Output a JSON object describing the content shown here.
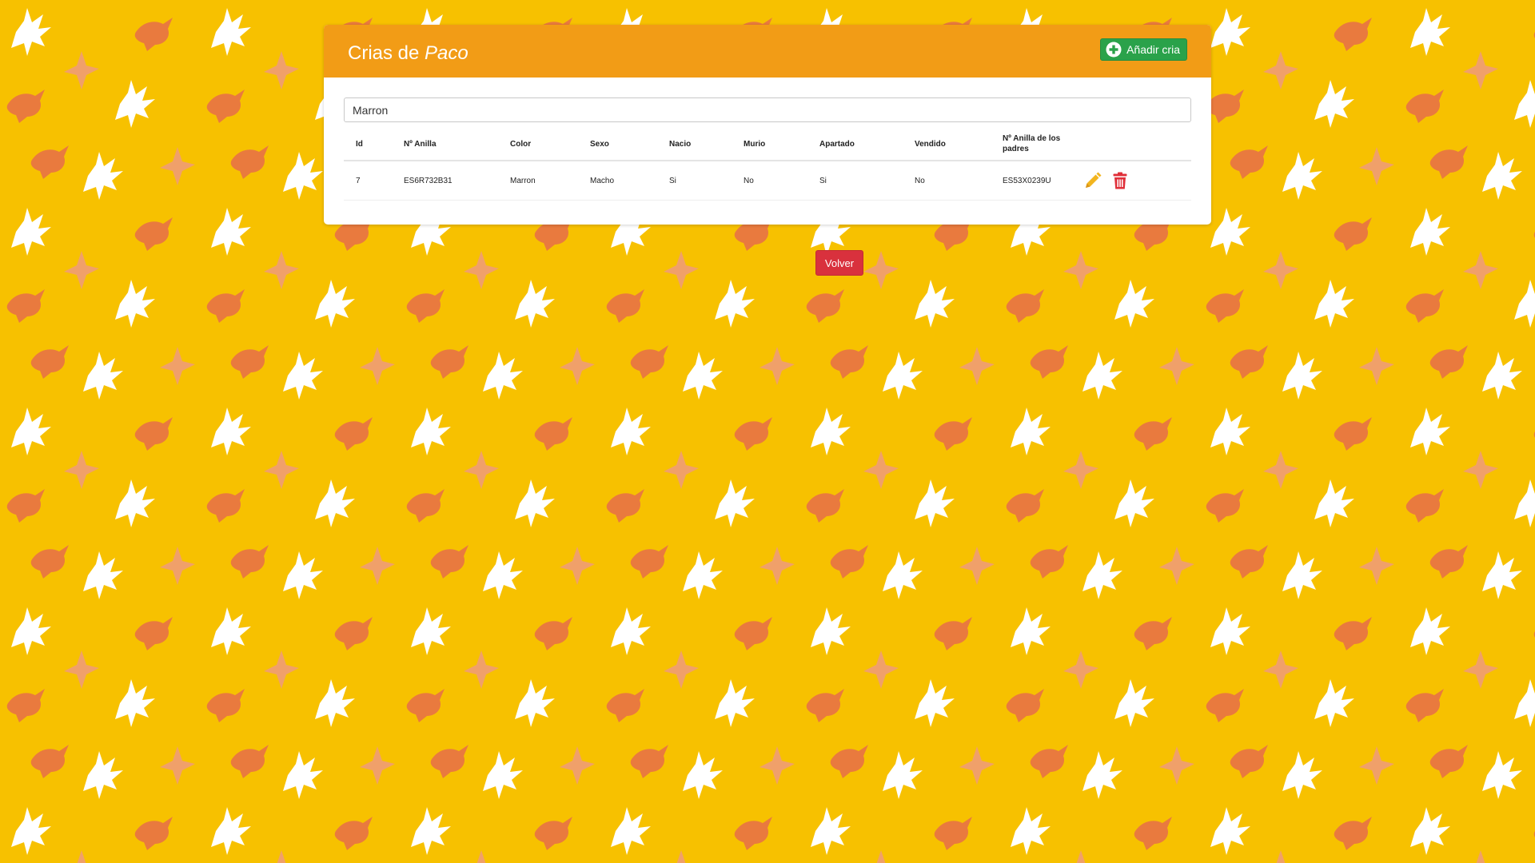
{
  "page": {
    "title_prefix": "Crias de",
    "title_name": "Paco"
  },
  "toolbar": {
    "add_label": "Añadir cria",
    "add_icon": "plus-circle-icon"
  },
  "search": {
    "value": "Marron"
  },
  "table": {
    "headers": [
      "Id",
      "Nº Anilla",
      "Color",
      "Sexo",
      "Nacio",
      "Murio",
      "Apartado",
      "Vendido",
      "Nº Anilla de los padres"
    ],
    "rows": [
      {
        "id": "7",
        "anilla": "ES6R732B31",
        "color": "Marron",
        "sexo": "Macho",
        "nacio": "Si",
        "murio": "No",
        "apartado": "Si",
        "vendido": "No",
        "anilla_padres": "ES53X0239U",
        "edit_icon": "pencil-icon",
        "delete_icon": "trash-icon"
      }
    ]
  },
  "footer": {
    "back_label": "Volver"
  },
  "colors": {
    "background": "#f7c100",
    "header": "#f29c16",
    "add_button": "#2aa24a",
    "back_button": "#d9313d",
    "edit_icon": "#f2b51f",
    "delete_icon": "#e0303a",
    "pattern_white": "#ffffff",
    "pattern_orange": "#e97a3e",
    "pattern_peach": "#f0a06a"
  }
}
